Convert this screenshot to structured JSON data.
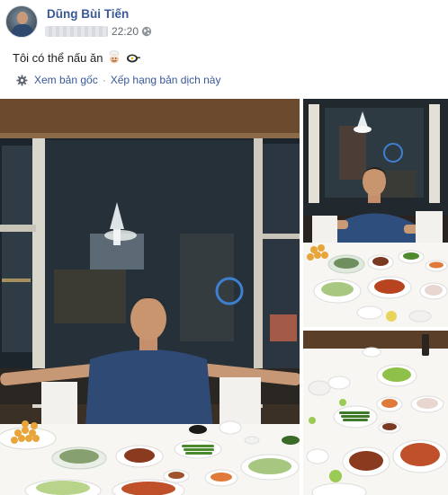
{
  "post": {
    "author": "Dũng Bùi Tiến",
    "time": "22:20",
    "status_text": "Tôi có thể nấu ăn",
    "emojis": [
      "chef-face-emoji",
      "frying-pan-egg-emoji"
    ]
  },
  "translate": {
    "see_original": "Xem bản gốc",
    "rate_translation": "Xếp hạng bản dịch này"
  },
  "photos": [
    {
      "name": "main-photo",
      "subject": "dinner-table-wide"
    },
    {
      "name": "side-photo-top",
      "subject": "dinner-table-overview"
    },
    {
      "name": "side-photo-bottom",
      "subject": "dinner-dishes-closeup"
    }
  ],
  "colors": {
    "link": "#385898",
    "meta_text": "#616770",
    "body_text": "#1c1e21"
  }
}
